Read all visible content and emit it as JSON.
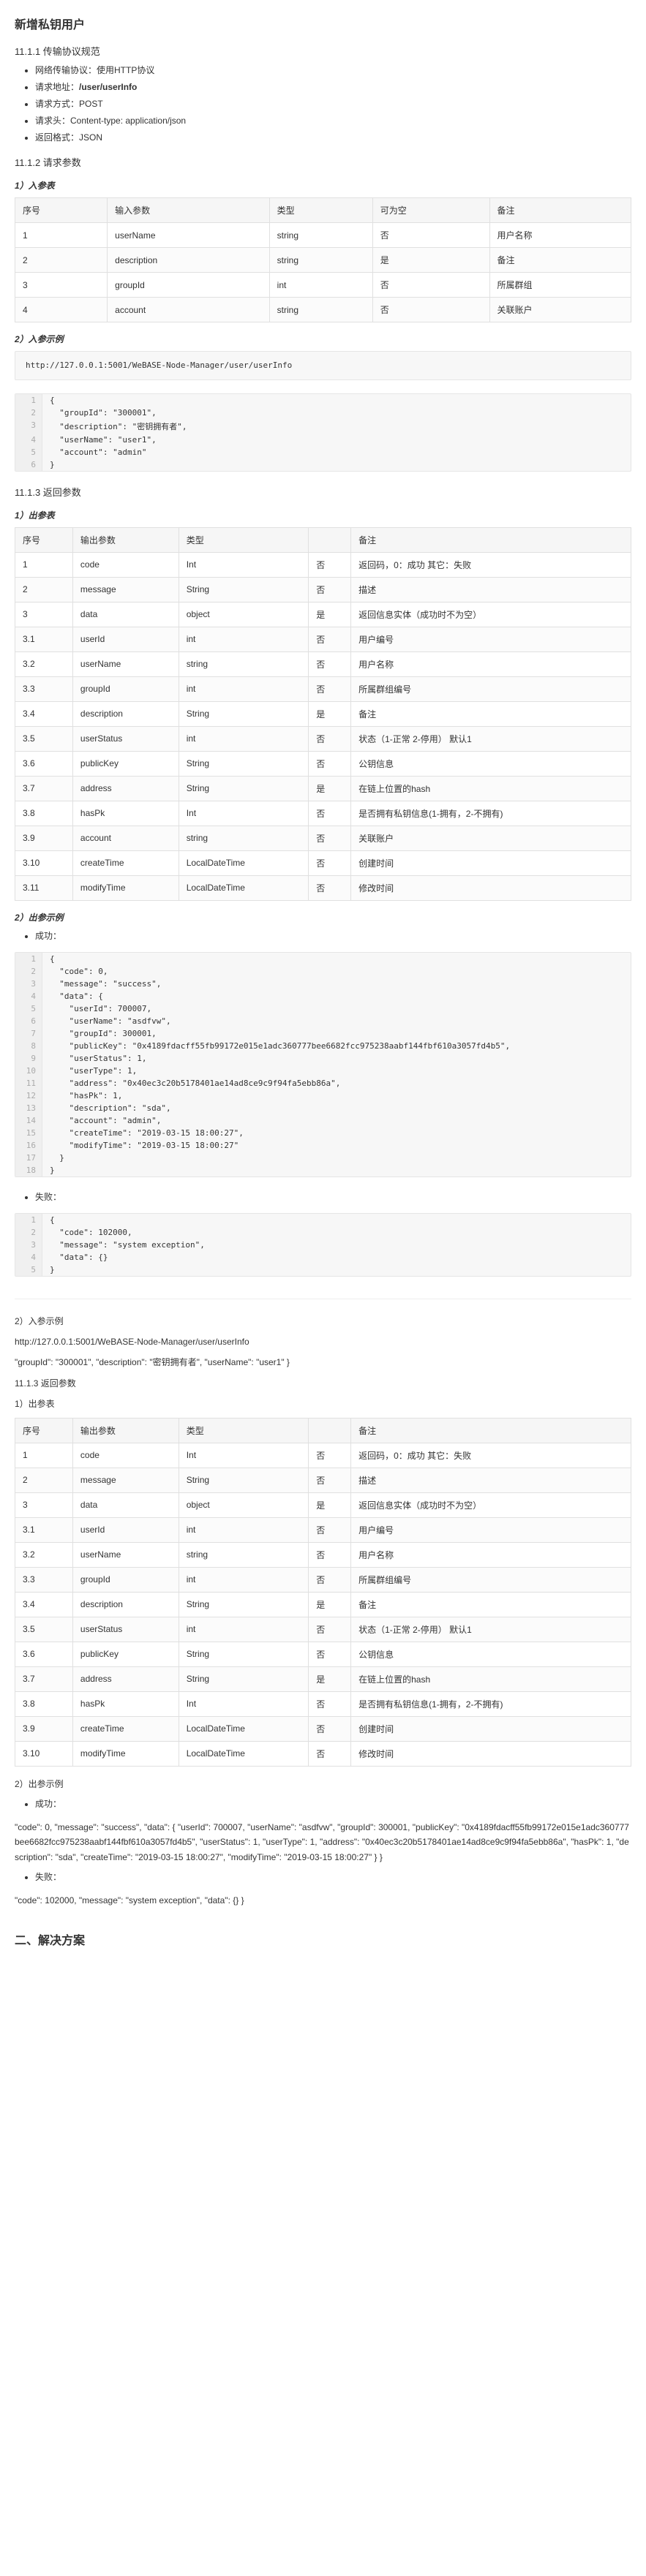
{
  "top": {
    "title": "新增私钥用户",
    "sec_protocol": "11.1.1 传输协议规范",
    "protocol_items": [
      {
        "label": "网络传输协议：使用HTTP协议",
        "bold": ""
      },
      {
        "label": "请求地址：",
        "bold": "/user/userInfo"
      },
      {
        "label": "请求方式：POST",
        "bold": ""
      },
      {
        "label": "请求头：Content-type: application/json",
        "bold": ""
      },
      {
        "label": "返回格式：JSON",
        "bold": ""
      }
    ],
    "sec_req_param": "11.1.2 请求参数",
    "sub_in_table": "1）入参表",
    "in_table": {
      "headers": [
        "序号",
        "输入参数",
        "类型",
        "可为空",
        "备注"
      ],
      "rows": [
        [
          "1",
          "userName",
          "string",
          "否",
          "用户名称"
        ],
        [
          "2",
          "description",
          "string",
          "是",
          "备注"
        ],
        [
          "3",
          "groupId",
          "int",
          "否",
          "所属群组"
        ],
        [
          "4",
          "account",
          "string",
          "否",
          "关联账户"
        ]
      ]
    },
    "sub_in_example": "2）入参示例",
    "url": "http://127.0.0.1:5001/WeBASE-Node-Manager/user/userInfo",
    "in_example_json_lines": [
      "{",
      "  \"groupId\": \"300001\",",
      "  \"description\": \"密钥拥有者\",",
      "  \"userName\": \"user1\",",
      "  \"account\": \"admin\"",
      "}"
    ],
    "sec_res_param": "11.1.3 返回参数",
    "sub_out_table": "1）出参表",
    "out_table": {
      "headers": [
        "序号",
        "输出参数",
        "类型",
        "",
        "备注"
      ],
      "rows": [
        [
          "1",
          "code",
          "Int",
          "否",
          "返回码，0：成功 其它：失败"
        ],
        [
          "2",
          "message",
          "String",
          "否",
          "描述"
        ],
        [
          "3",
          "data",
          "object",
          "是",
          "返回信息实体（成功时不为空）"
        ],
        [
          "3.1",
          "userId",
          "int",
          "否",
          "用户编号"
        ],
        [
          "3.2",
          "userName",
          "string",
          "否",
          "用户名称"
        ],
        [
          "3.3",
          "groupId",
          "int",
          "否",
          "所属群组编号"
        ],
        [
          "3.4",
          "description",
          "String",
          "是",
          "备注"
        ],
        [
          "3.5",
          "userStatus",
          "int",
          "否",
          "状态（1-正常 2-停用） 默认1"
        ],
        [
          "3.6",
          "publicKey",
          "String",
          "否",
          "公钥信息"
        ],
        [
          "3.7",
          "address",
          "String",
          "是",
          "在链上位置的hash"
        ],
        [
          "3.8",
          "hasPk",
          "Int",
          "否",
          "是否拥有私钥信息(1-拥有，2-不拥有)"
        ],
        [
          "3.9",
          "account",
          "string",
          "否",
          "关联账户"
        ],
        [
          "3.10",
          "createTime",
          "LocalDateTime",
          "否",
          "创建时间"
        ],
        [
          "3.11",
          "modifyTime",
          "LocalDateTime",
          "否",
          "修改时间"
        ]
      ]
    },
    "sub_out_example": "2）出参示例",
    "success_label": "成功：",
    "success_json_lines": [
      "{",
      "  \"code\": 0,",
      "  \"message\": \"success\",",
      "  \"data\": {",
      "    \"userId\": 700007,",
      "    \"userName\": \"asdfvw\",",
      "    \"groupId\": 300001,",
      "    \"publicKey\": \"0x4189fdacff55fb99172e015e1adc360777bee6682fcc975238aabf144fbf610a3057fd4b5\",",
      "    \"userStatus\": 1,",
      "    \"userType\": 1,",
      "    \"address\": \"0x40ec3c20b5178401ae14ad8ce9c9f94fa5ebb86a\",",
      "    \"hasPk\": 1,",
      "    \"description\": \"sda\",",
      "    \"account\": \"admin\",",
      "    \"createTime\": \"2019-03-15 18:00:27\",",
      "    \"modifyTime\": \"2019-03-15 18:00:27\"",
      "  }",
      "}"
    ],
    "fail_label": "失败：",
    "fail_json_lines": [
      "{",
      "  \"code\": 102000,",
      "  \"message\": \"system exception\",",
      "  \"data\": {}",
      "}"
    ]
  },
  "bottom": {
    "sec_in_example": "2）入参示例",
    "url_text": "http://127.0.0.1:5001/WeBASE-Node-Manager/user/userInfo",
    "body_text": "\"groupId\": \"300001\", \"description\": \"密钥拥有者\", \"userName\": \"user1\" }",
    "sec_res_param": "11.1.3 返回参数",
    "sub_out_table": "1）出参表",
    "out_table": {
      "headers": [
        "序号",
        "输出参数",
        "类型",
        "",
        "备注"
      ],
      "rows": [
        [
          "1",
          "code",
          "Int",
          "否",
          "返回码，0：成功 其它：失败"
        ],
        [
          "2",
          "message",
          "String",
          "否",
          "描述"
        ],
        [
          "3",
          "data",
          "object",
          "是",
          "返回信息实体（成功时不为空）"
        ],
        [
          "3.1",
          "userId",
          "int",
          "否",
          "用户编号"
        ],
        [
          "3.2",
          "userName",
          "string",
          "否",
          "用户名称"
        ],
        [
          "3.3",
          "groupId",
          "int",
          "否",
          "所属群组编号"
        ],
        [
          "3.4",
          "description",
          "String",
          "是",
          "备注"
        ],
        [
          "3.5",
          "userStatus",
          "int",
          "否",
          "状态（1-正常 2-停用） 默认1"
        ],
        [
          "3.6",
          "publicKey",
          "String",
          "否",
          "公钥信息"
        ],
        [
          "3.7",
          "address",
          "String",
          "是",
          "在链上位置的hash"
        ],
        [
          "3.8",
          "hasPk",
          "Int",
          "否",
          "是否拥有私钥信息(1-拥有，2-不拥有)"
        ],
        [
          "3.9",
          "createTime",
          "LocalDateTime",
          "否",
          "创建时间"
        ],
        [
          "3.10",
          "modifyTime",
          "LocalDateTime",
          "否",
          "修改时间"
        ]
      ]
    },
    "sub_out_example": "2）出参示例",
    "success_label": "成功：",
    "success_text": "\"code\": 0, \"message\": \"success\", \"data\": { \"userId\": 700007, \"userName\": \"asdfvw\", \"groupId\": 300001, \"publicKey\": \"0x4189fdacff55fb99172e015e1adc360777bee6682fcc975238aabf144fbf610a3057fd4b5\", \"userStatus\": 1, \"userType\": 1, \"address\": \"0x40ec3c20b5178401ae14ad8ce9c9f94fa5ebb86a\", \"hasPk\": 1, \"description\": \"sda\", \"createTime\": \"2019-03-15 18:00:27\", \"modifyTime\": \"2019-03-15 18:00:27\" } }",
    "fail_label": "失败：",
    "fail_text": "\"code\": 102000, \"message\": \"system exception\", \"data\": {} }",
    "solution_heading": "二、解决方案"
  }
}
